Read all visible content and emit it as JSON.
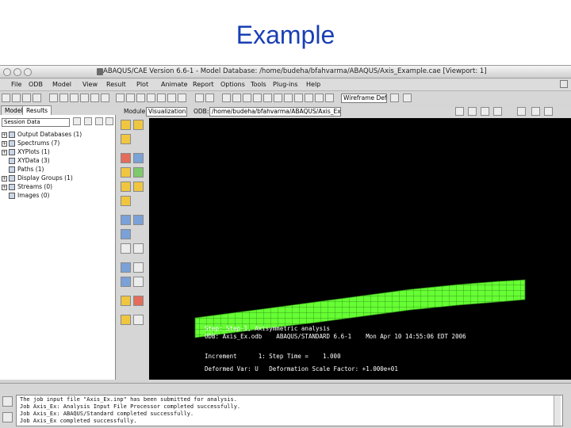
{
  "slide": {
    "title": "Example"
  },
  "window": {
    "title": "ABAQUS/CAE Version 6.6-1 - Model Database: /home/budeha/bfahvarma/ABAQUS/Axis_Example.cae [Viewport: 1]"
  },
  "menubar": {
    "items": [
      "File",
      "ODB",
      "Model",
      "View",
      "Result",
      "Plot",
      "Animate",
      "Report",
      "Options",
      "Tools",
      "Plug-ins",
      "Help"
    ]
  },
  "toolbar": {
    "render_style": "Wireframe  Default",
    "module_label": "Module:",
    "module_value": "Visualization",
    "odb_label": "ODB:",
    "odb_value": "/home/budeha/bfahvarma/ABAQUS/Axis_Ex.odb"
  },
  "left_panel": {
    "tabs": [
      "Model",
      "Results"
    ],
    "active_tab": "Results",
    "filter_value": "Session Data",
    "tree_items": [
      "Output Databases (1)",
      "Spectrums (7)",
      "XYPlots (1)",
      "XYData (3)",
      "Paths (1)",
      "Display Groups (1)",
      "Streams (0)",
      "Images (0)"
    ]
  },
  "viewport": {
    "caption_lines": [
      "ODB: Axis_Ex.odb    ABAQUS/STANDARD 6.6-1    Mon Apr 10 14:55:06 EDT 2006",
      "Step: Step-1, Axisymmetric analysis",
      "Increment      1: Step Time =    1.000",
      "Deformed Var: U   Deformation Scale Factor: +1.000e+01"
    ],
    "mesh_color": "#66ff33",
    "background_color": "#000000"
  },
  "messages": {
    "lines": [
      "The job input file \"Axis_Ex.inp\" has been submitted for analysis.",
      "Job Axis_Ex: Analysis Input File Processor completed successfully.",
      "Job Axis_Ex: ABAQUS/Standard completed successfully.",
      "Job Axis_Ex completed successfully."
    ]
  }
}
